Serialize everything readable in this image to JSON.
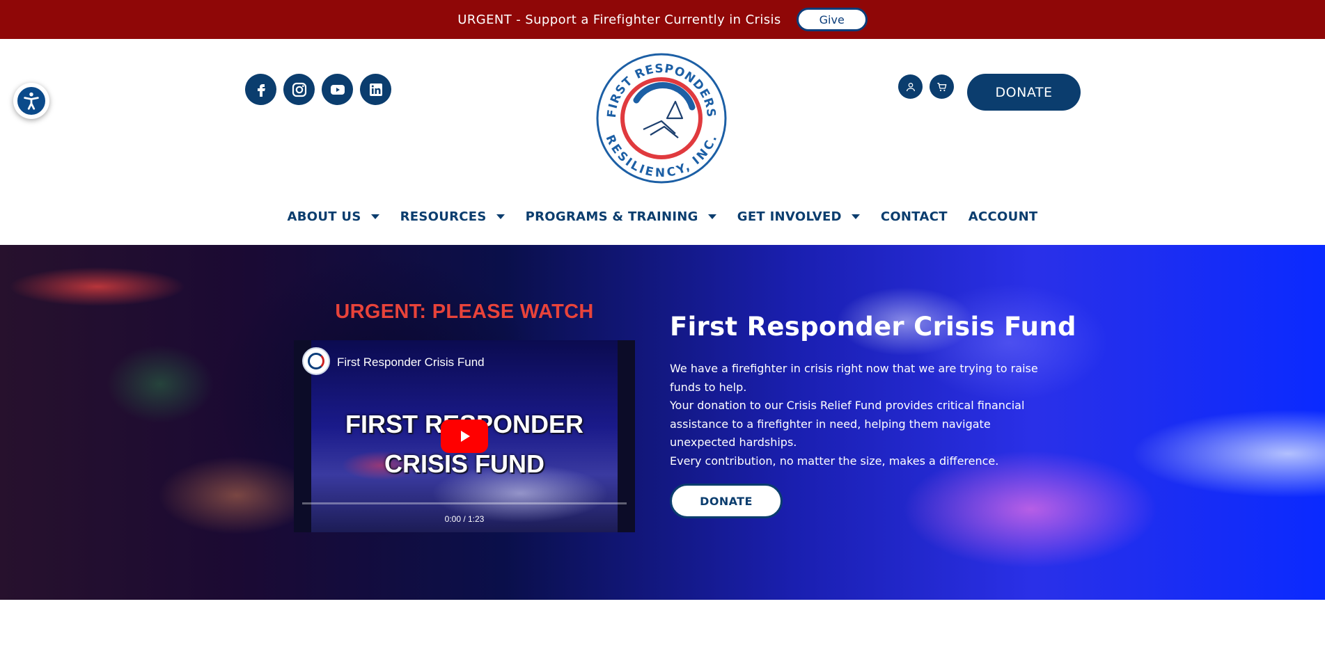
{
  "urgent_bar": {
    "text": "URGENT - Support a Firefighter Currently in Crisis",
    "give_label": "Give",
    "background": "#8f0707"
  },
  "header": {
    "social": [
      "facebook-icon",
      "instagram-icon",
      "youtube-icon",
      "linkedin-icon"
    ],
    "logo": {
      "top_text": "FIRST RESPONDERS",
      "bottom_text": "RESILIENCY, INC."
    },
    "account_icon": "user-icon",
    "cart_icon": "cart-icon",
    "donate_label": "DONATE"
  },
  "nav": {
    "items": [
      {
        "label": "ABOUT US",
        "dropdown": true
      },
      {
        "label": "RESOURCES",
        "dropdown": true
      },
      {
        "label": "PROGRAMS & TRAINING",
        "dropdown": true
      },
      {
        "label": "GET INVOLVED",
        "dropdown": true
      },
      {
        "label": "CONTACT",
        "dropdown": false
      },
      {
        "label": "ACCOUNT",
        "dropdown": false
      }
    ]
  },
  "hero": {
    "watch_heading": "URGENT: PLEASE WATCH",
    "video": {
      "title": "First Responder Crisis Fund",
      "overlay_line1": "FIRST RESPONDER",
      "overlay_line2": "CRISIS FUND",
      "time": "0:00 / 1:23",
      "progress": 0
    },
    "fund_title": "First Responder Crisis Fund",
    "fund_paragraph_1": "We have a firefighter in crisis right now that we are trying to raise funds to help.",
    "fund_paragraph_2": "Your donation to our Crisis Relief Fund provides critical financial assistance to a firefighter in need, helping them navigate unexpected hardships.",
    "fund_paragraph_3": "Every contribution, no matter the size, makes a difference.",
    "donate_label": "DONATE"
  },
  "colors": {
    "brand_navy": "#0b3d6e",
    "urgent_red": "#8f0707",
    "accent_red": "#e8433a"
  }
}
